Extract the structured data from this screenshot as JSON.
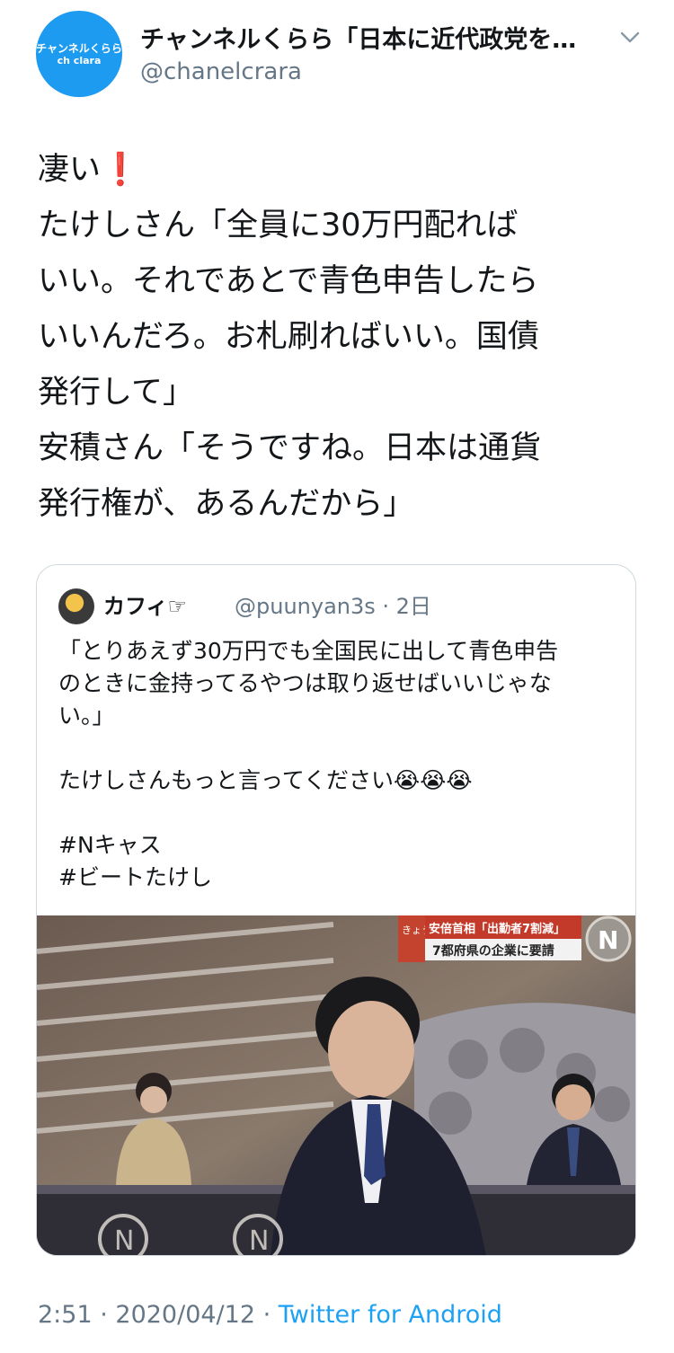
{
  "author": {
    "avatar_line1": "チャンネルくらら",
    "avatar_line2": "ch clara",
    "display_name": "チャンネルくらら「日本に近代政党を…",
    "handle": "@chanelcrara"
  },
  "tweet": {
    "lines": [
      "凄い",
      "たけしさん「全員に30万円配れば",
      "いい。それであとで青色申告したら",
      "いいんだろ。お札刷ればいい。国債",
      "発行して」",
      "安積さん「そうですね。日本は通貨",
      "発行権が、あるんだから」"
    ],
    "emoji": "❗"
  },
  "quoted": {
    "name": "カフィ☞",
    "handle": "@puunyan3s",
    "time": "2日",
    "body_lines": [
      "「とりあえず30万円でも全国民に出して青色申告",
      "のときに金持ってるやつは取り返せばいいじゃな",
      "い。」",
      "",
      "たけしさんもっと言ってください😭😭😭",
      "",
      "#Nキャス",
      "#ビートたけし"
    ],
    "media": {
      "caption_tag": "きょう",
      "caption_line1": "安倍首相「出勤者7割減」",
      "caption_line2": "7都府県の企業に要請",
      "logo": "N"
    }
  },
  "footer": {
    "time": "2:51",
    "date": "2020/04/12",
    "separator": " · ",
    "app": "Twitter for Android"
  },
  "colors": {
    "link": "#1da1f2",
    "secondary": "#657786",
    "avatar_bg": "#1d9bf0"
  }
}
